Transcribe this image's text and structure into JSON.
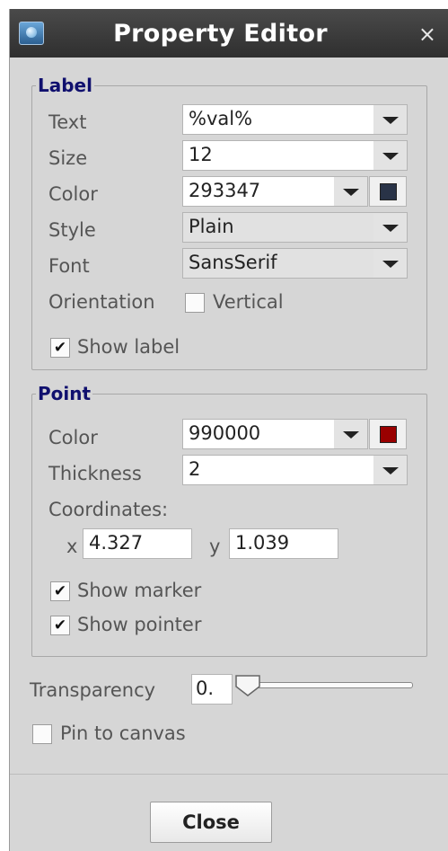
{
  "window": {
    "title": "Property Editor",
    "close_glyph": "×",
    "app_icon": "geogebra-icon"
  },
  "label_section": {
    "legend": "Label",
    "text": {
      "label": "Text",
      "value": "%val%"
    },
    "size": {
      "label": "Size",
      "value": "12"
    },
    "color": {
      "label": "Color",
      "value": "293347",
      "swatch": "#293347"
    },
    "style": {
      "label": "Style",
      "value": "Plain"
    },
    "font": {
      "label": "Font",
      "value": "SansSerif"
    },
    "orientation": {
      "label": "Orientation",
      "checkbox_label": "Vertical",
      "checked": false
    },
    "show_label": {
      "label": "Show label",
      "checked": true
    }
  },
  "point_section": {
    "legend": "Point",
    "color": {
      "label": "Color",
      "value": "990000",
      "swatch": "#990000"
    },
    "thickness": {
      "label": "Thickness",
      "value": "2"
    },
    "coordinates": {
      "label": "Coordinates:",
      "x_label": "x",
      "x_value": "4.327",
      "y_label": "y",
      "y_value": "1.039"
    },
    "show_marker": {
      "label": "Show marker",
      "checked": true
    },
    "show_pointer": {
      "label": "Show pointer",
      "checked": true
    }
  },
  "transparency": {
    "label": "Transparency",
    "value": "0.",
    "slider_level": 0
  },
  "pin_to_canvas": {
    "label": "Pin to canvas",
    "checked": false
  },
  "footer": {
    "close_label": "Close"
  }
}
